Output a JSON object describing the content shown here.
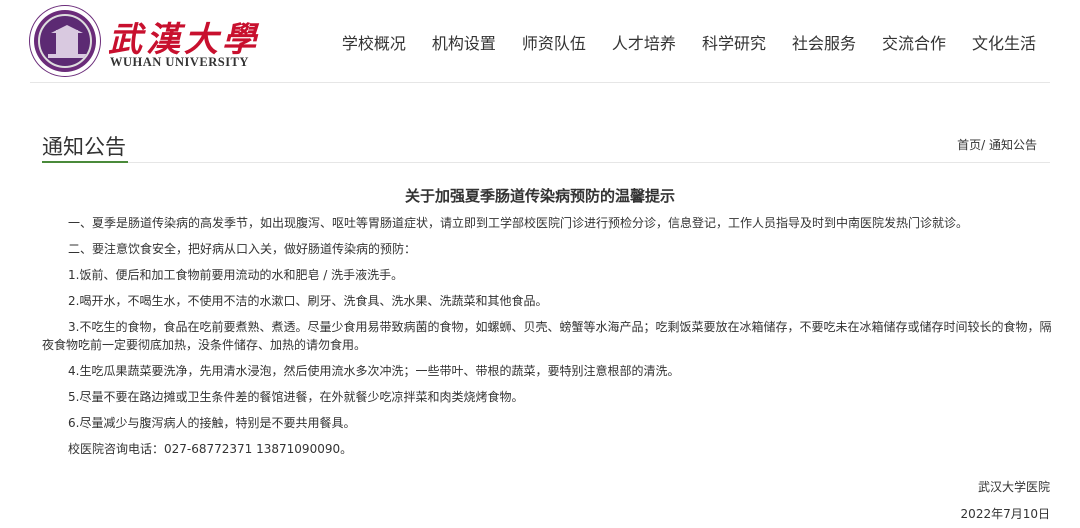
{
  "header": {
    "logo_cn": "武漢大學",
    "logo_en": "WUHAN UNIVERSITY",
    "nav": [
      "学校概况",
      "机构设置",
      "师资队伍",
      "人才培养",
      "科学研究",
      "社会服务",
      "交流合作",
      "文化生活"
    ]
  },
  "section": {
    "title": "通知公告",
    "breadcrumb_home": "首页/",
    "breadcrumb_current": "通知公告"
  },
  "article": {
    "title": "关于加强夏季肠道传染病预防的温馨提示",
    "paragraphs": [
      "一、夏季是肠道传染病的高发季节，如出现腹泻、呕吐等胃肠道症状，请立即到工学部校医院门诊进行预检分诊，信息登记，工作人员指导及时到中南医院发热门诊就诊。",
      "二、要注意饮食安全，把好病从口入关，做好肠道传染病的预防：",
      "1.饭前、便后和加工食物前要用流动的水和肥皂 / 洗手液洗手。",
      "2.喝开水，不喝生水，不使用不洁的水漱口、刷牙、洗食具、洗水果、洗蔬菜和其他食品。",
      "3.不吃生的食物，食品在吃前要煮熟、煮透。尽量少食用易带致病菌的食物，如螺蛳、贝壳、螃蟹等水海产品；吃剩饭菜要放在冰箱储存，不要吃未在冰箱储存或储存时间较长的食物，隔夜食物吃前一定要彻底加热，没条件储存、加热的请勿食用。",
      "4.生吃瓜果蔬菜要洗净，先用清水浸泡，然后使用流水多次冲洗；一些带叶、带根的蔬菜，要特别注意根部的清洗。",
      "5.尽量不要在路边摊或卫生条件差的餐馆进餐，在外就餐少吃凉拌菜和肉类烧烤食物。",
      "6.尽量减少与腹泻病人的接触，特别是不要共用餐具。",
      "校医院咨询电话：027-68772371 13871090090。"
    ],
    "signature": "武汉大学医院",
    "date": "2022年7月10日"
  }
}
